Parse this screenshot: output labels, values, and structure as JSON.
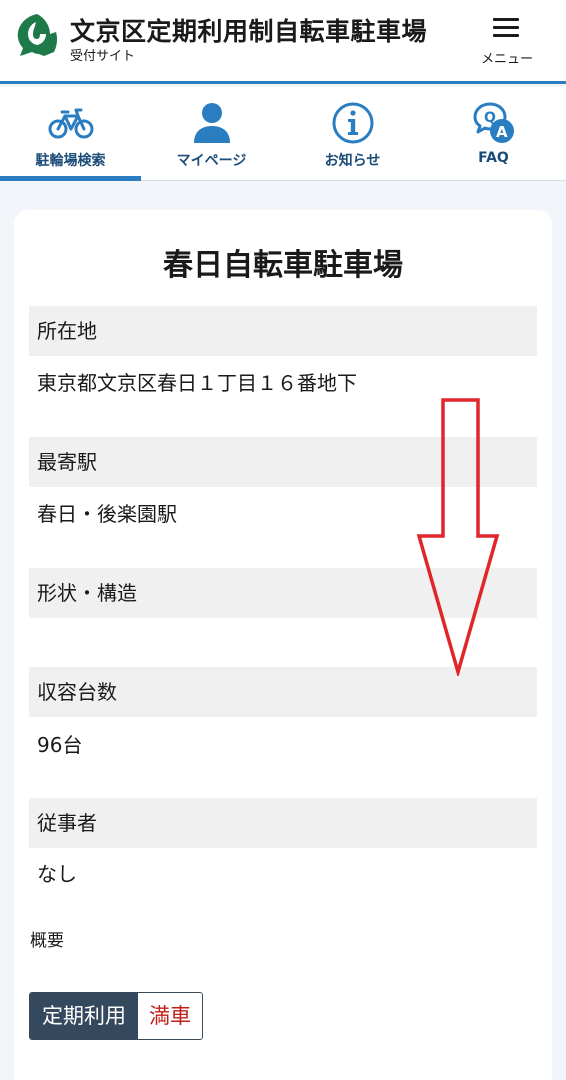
{
  "header": {
    "title": "文京区定期利用制自転車駐車場",
    "subtitle": "受付サイト",
    "menu_label": "メニュー",
    "logo_icon": "bunkyo-ward-emblem-icon",
    "colors": {
      "accent": "#2a7dc0",
      "nav_text": "#1b4c79",
      "logo": "#1f7a4a"
    }
  },
  "nav": {
    "items": [
      {
        "label": "駐輪場検索",
        "icon": "bicycle-icon",
        "active": true
      },
      {
        "label": "マイページ",
        "icon": "user-icon",
        "active": false
      },
      {
        "label": "お知らせ",
        "icon": "info-icon",
        "active": false
      },
      {
        "label": "FAQ",
        "icon": "faq-icon",
        "active": false
      }
    ]
  },
  "facility": {
    "name": "春日自転車駐車場",
    "fields": [
      {
        "label": "所在地",
        "value": "東京都文京区春日１丁目１６番地下"
      },
      {
        "label": "最寄駅",
        "value": "春日・後楽園駅"
      },
      {
        "label": "形状・構造",
        "value": ""
      },
      {
        "label": "収容台数",
        "value": "96台"
      },
      {
        "label": "従事者",
        "value": "なし"
      }
    ],
    "summary_label": "概要",
    "status": {
      "type": "定期利用",
      "availability": "満車",
      "availability_color": "#c0201a"
    }
  },
  "annotation": {
    "icon": "down-arrow-icon",
    "color": "#e0262b"
  }
}
